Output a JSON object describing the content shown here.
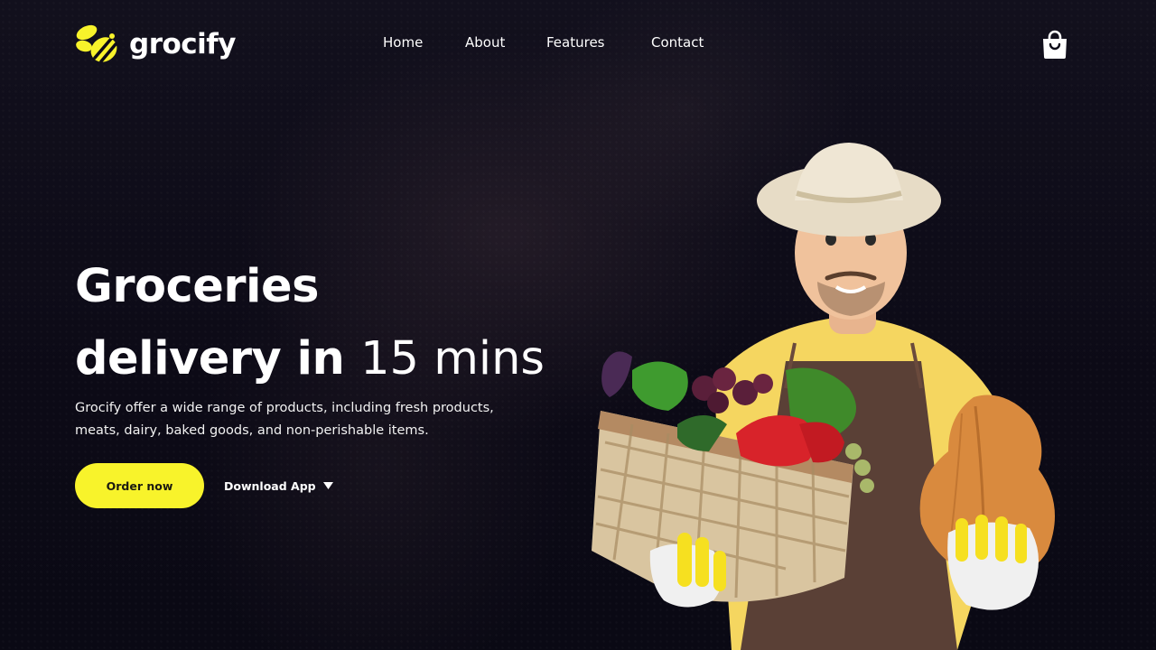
{
  "brand": {
    "name": "grocify",
    "accent_color": "#f8f32b",
    "logo_icon": "bee-icon"
  },
  "nav": {
    "items": [
      {
        "label": "Home"
      },
      {
        "label": "About"
      },
      {
        "label": "Features"
      },
      {
        "label": "Contact"
      }
    ]
  },
  "header": {
    "cart_icon": "shopping-bag-icon"
  },
  "hero": {
    "title_line1": "Groceries",
    "title_line2_bold": "delivery in",
    "title_line2_light": "15 mins",
    "description_line1": "Grocify offer a wide range of products, including fresh products,",
    "description_line2": "meats, dairy, baked goods, and non-perishable items.",
    "primary_button": "Order now",
    "secondary_button": "Download App",
    "secondary_icon": "caret-down-icon",
    "illustration": "farmer-with-vegetable-basket"
  }
}
